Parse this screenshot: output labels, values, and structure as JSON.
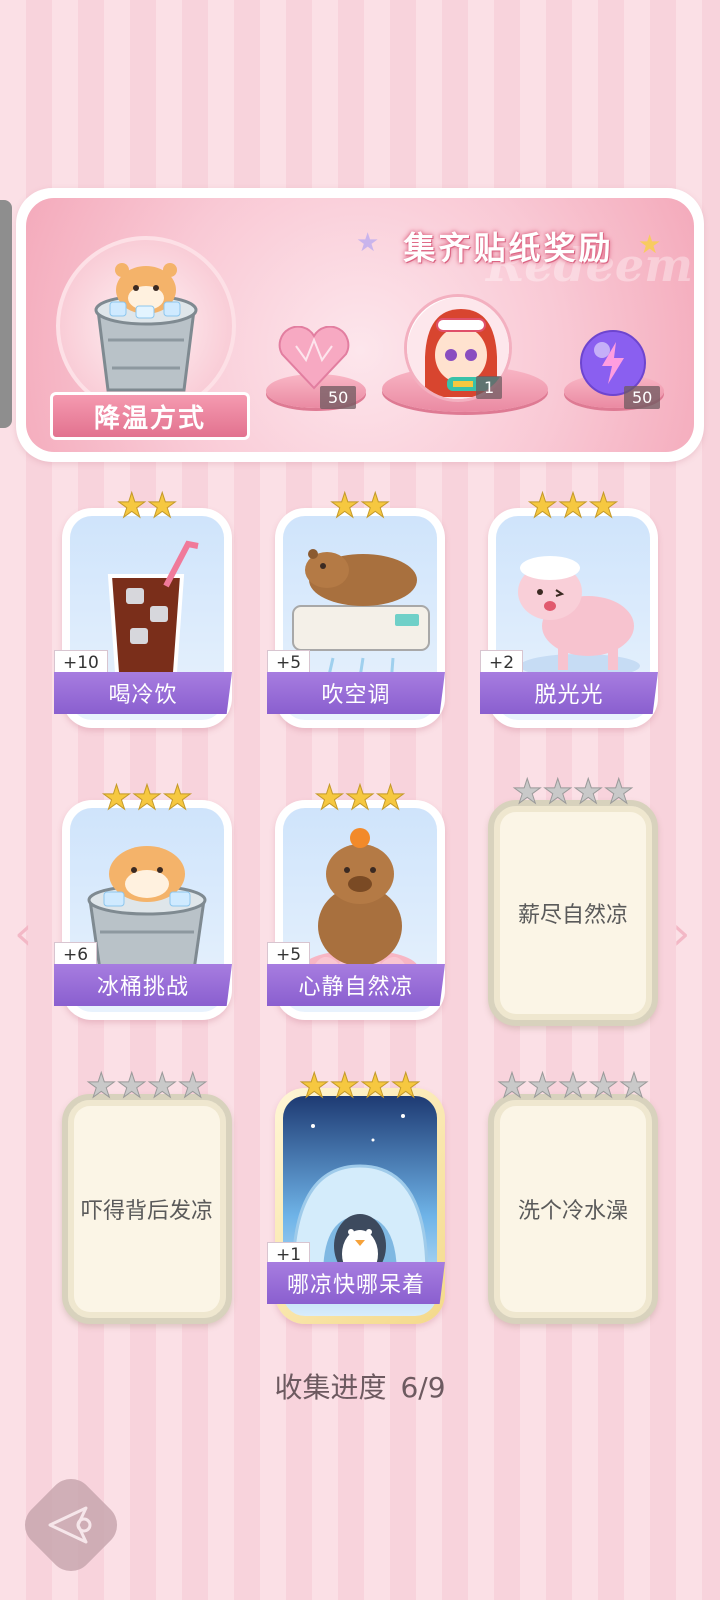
{
  "banner": {
    "title": "集齐贴纸奖励",
    "watermark": "Redeem",
    "method_label": "降温方式",
    "rewards": [
      {
        "icon": "pink-heart-gem-icon",
        "count": "50"
      },
      {
        "icon": "red-hair-girl-avatar",
        "count": "1"
      },
      {
        "icon": "purple-lightning-orb-icon",
        "count": "50"
      }
    ]
  },
  "cards": [
    {
      "label": "喝冷饮",
      "bonus": "+10",
      "stars": 2,
      "image": "iced-cola-icon",
      "unlocked": true
    },
    {
      "label": "吹空调",
      "bonus": "+5",
      "stars": 2,
      "image": "capybara-air-conditioner-icon",
      "unlocked": true
    },
    {
      "label": "脱光光",
      "bonus": "+2",
      "stars": 3,
      "image": "sheared-sheep-icon",
      "unlocked": true
    },
    {
      "label": "冰桶挑战",
      "bonus": "+6",
      "stars": 3,
      "image": "hamster-ice-bucket-icon",
      "unlocked": true
    },
    {
      "label": "心静自然凉",
      "bonus": "+5",
      "stars": 3,
      "image": "meditating-capybara-icon",
      "unlocked": true
    },
    {
      "label": "薪尽自然凉",
      "stars": 4,
      "unlocked": false
    },
    {
      "label": "吓得背后发凉",
      "stars": 4,
      "unlocked": false
    },
    {
      "label": "哪凉快哪呆着",
      "bonus": "+1",
      "stars": 4,
      "image": "penguin-igloo-icon",
      "unlocked": true
    },
    {
      "label": "洗个冷水澡",
      "stars": 5,
      "unlocked": false
    }
  ],
  "progress": {
    "label": "收集进度",
    "value": "6/9",
    "collected": 6,
    "total": 9
  },
  "nav": {
    "prev_icon": "chevron-left-icon",
    "next_icon": "chevron-right-icon",
    "back_icon": "back-arrow-icon"
  },
  "colors": {
    "accent_pink": "#e2728f",
    "label_purple": "#8a5fcf",
    "star_gold": "#f6c840"
  }
}
